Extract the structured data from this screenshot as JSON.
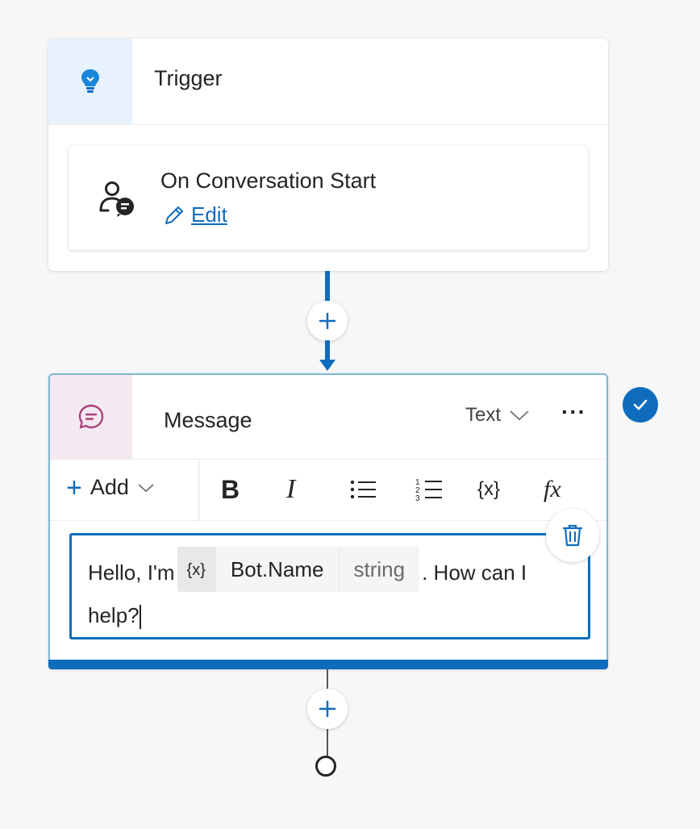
{
  "trigger_node": {
    "title": "Trigger",
    "icon": "lightbulb-icon",
    "event": {
      "icon": "conversation-start-icon",
      "title": "On Conversation Start",
      "edit_label": "Edit"
    }
  },
  "message_node": {
    "title": "Message",
    "icon": "chat-bubble-icon",
    "type_select": "Text",
    "more_label": "···",
    "toolbar": {
      "add_label": "Add",
      "bold_label": "B",
      "italic_label": "I",
      "variable_label": "{x}",
      "formula_label": "fx"
    },
    "content": {
      "prefix": "Hello, I'm",
      "variable": {
        "icon_label": "{x}",
        "name": "Bot.Name",
        "type": "string"
      },
      "suffix": ". How can I help?"
    },
    "status": "check-icon"
  },
  "colors": {
    "accent": "#0f6cbd",
    "trigger_tile": "#e7f2fc",
    "message_tile": "#f4e9f0",
    "message_icon": "#a8427a"
  }
}
